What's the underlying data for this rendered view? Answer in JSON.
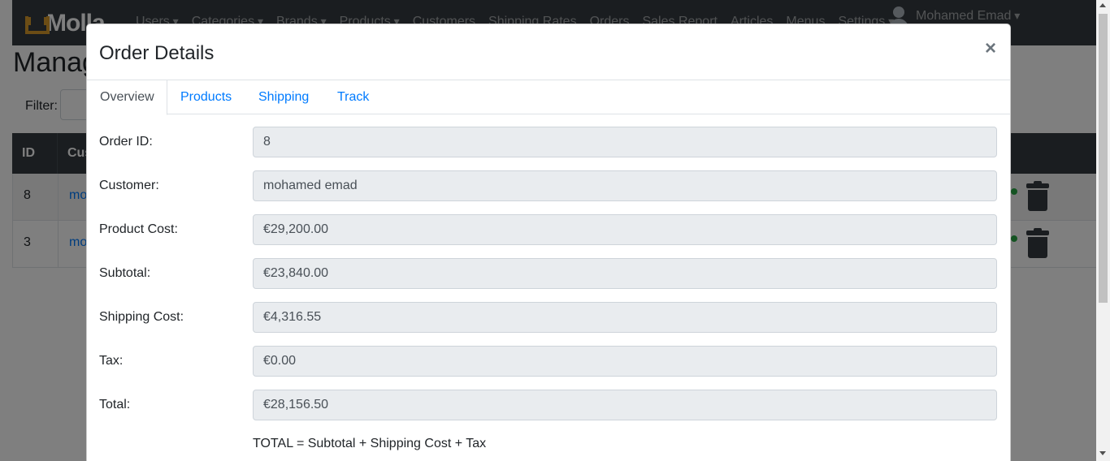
{
  "navbar": {
    "brand": "Molla",
    "items": [
      {
        "label": "Users",
        "dropdown": true
      },
      {
        "label": "Categories",
        "dropdown": true
      },
      {
        "label": "Brands",
        "dropdown": true
      },
      {
        "label": "Products",
        "dropdown": true
      },
      {
        "label": "Customers",
        "dropdown": false
      },
      {
        "label": "Shipping Rates",
        "dropdown": false
      },
      {
        "label": "Orders",
        "dropdown": false
      },
      {
        "label": "Sales Report",
        "dropdown": false
      },
      {
        "label": "Articles",
        "dropdown": false
      },
      {
        "label": "Menus",
        "dropdown": false
      },
      {
        "label": "Settings",
        "dropdown": true
      }
    ],
    "user": "Mohamed Emad"
  },
  "page": {
    "title": "Manag",
    "filter_label": "Filter:"
  },
  "table": {
    "headers": [
      "ID",
      "Cus"
    ],
    "rows": [
      {
        "id": "8",
        "customer": "mo"
      },
      {
        "id": "3",
        "customer": "mo"
      }
    ]
  },
  "modal": {
    "title": "Order Details",
    "close": "×",
    "tabs": [
      "Overview",
      "Products",
      "Shipping",
      "Track"
    ],
    "active_tab": "Overview",
    "fields": [
      {
        "label": "Order ID:",
        "value": "8"
      },
      {
        "label": "Customer:",
        "value": "mohamed emad"
      },
      {
        "label": "Product Cost:",
        "value": "€29,200.00"
      },
      {
        "label": "Subtotal:",
        "value": "€23,840.00"
      },
      {
        "label": "Shipping Cost:",
        "value": "€4,316.55"
      },
      {
        "label": "Tax:",
        "value": "€0.00"
      },
      {
        "label": "Total:",
        "value": "€28,156.50"
      }
    ],
    "formula": "TOTAL = Subtotal + Shipping Cost + Tax"
  },
  "colors": {
    "navbar_bg": "#343a40",
    "brand_accent": "#d99a2b",
    "link": "#007bff",
    "readonly_field_bg": "#e9ecef"
  }
}
